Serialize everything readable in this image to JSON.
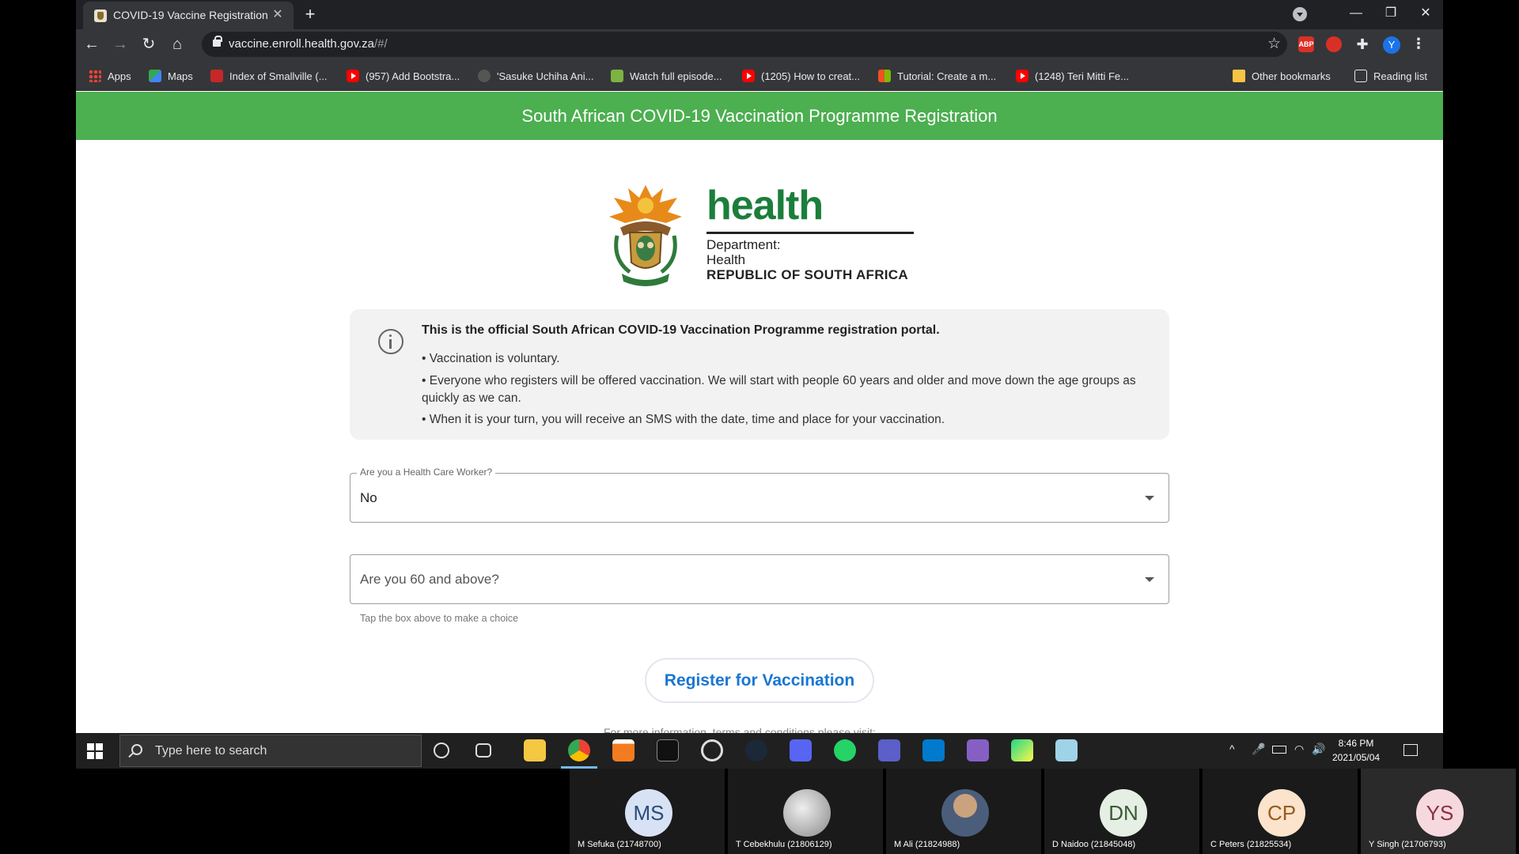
{
  "browser": {
    "tab_title": "COVID-19 Vaccine Registration",
    "tab_close": "✕",
    "new_tab": "+",
    "url_host": "vaccine.enroll.health.gov.za",
    "url_path": "/#/",
    "bookmarks": [
      {
        "label": "Apps",
        "icon": "apps-icon"
      },
      {
        "label": "Maps",
        "icon": "maps-icon"
      },
      {
        "label": "Index of Smallville (...",
        "icon": "site-icon"
      },
      {
        "label": "(957) Add Bootstra...",
        "icon": "youtube-icon"
      },
      {
        "label": "'Sasuke Uchiha Ani...",
        "icon": "site-icon"
      },
      {
        "label": "Watch full episode...",
        "icon": "site-icon"
      },
      {
        "label": "(1205) How to creat...",
        "icon": "youtube-icon"
      },
      {
        "label": "Tutorial: Create a m...",
        "icon": "microsoft-icon"
      },
      {
        "label": "(1248) Teri Mitti Fe...",
        "icon": "youtube-icon"
      }
    ],
    "other_bookmarks": "Other bookmarks",
    "reading_list": "Reading list",
    "profile_initial": "Y",
    "ext_abp": "ABP"
  },
  "page": {
    "header_title": "South African COVID-19 Vaccination Programme Registration",
    "logo": {
      "wordmark": "health",
      "line1": "Department:",
      "line2": "Health",
      "line3": "REPUBLIC OF SOUTH AFRICA"
    },
    "info": {
      "title": "This is the official South African COVID-19 Vaccination Programme registration portal.",
      "bullet1": "• Vaccination is voluntary.",
      "bullet2": "• Everyone who registers will be offered vaccination. We will start with people 60 years and older and move down the age groups as quickly as we can.",
      "bullet3": "• When it is your turn, you will receive an SMS with the date, time and place for your vaccination."
    },
    "health_worker_field": {
      "label": "Are you a Health Care Worker?",
      "value": "No"
    },
    "age_field": {
      "placeholder": "Are you 60 and above?",
      "hint": "Tap the box above to make a choice"
    },
    "register_button": "Register for Vaccination",
    "footer_partial": "For more information, terms and conditions please visit:"
  },
  "taskbar": {
    "search_placeholder": "Type here to search",
    "time": "8:46 PM",
    "date": "2021/05/04",
    "pinned": [
      "cortana-icon",
      "task-view-icon",
      "file-explorer-icon",
      "chrome-icon",
      "vlc-icon",
      "epic-games-icon",
      "obs-icon",
      "steam-icon",
      "discord-icon",
      "whatsapp-icon",
      "teams-icon",
      "vscode-icon",
      "visual-studio-icon",
      "pycharm-icon",
      "notepad-icon"
    ]
  },
  "participants": [
    {
      "initials": "MS",
      "name": "M Sefuka (21748700)",
      "color": "#d7e3f4",
      "text": "#2d4a7a"
    },
    {
      "initials": "",
      "name": "T Cebekhulu (21806129)",
      "color": "#cfcfcf",
      "text": "#333333"
    },
    {
      "initials": "",
      "name": "M Ali (21824988)",
      "color": "#6b7a8f",
      "text": "#ffffff"
    },
    {
      "initials": "DN",
      "name": "D Naidoo (21845048)",
      "color": "#e5efe3",
      "text": "#3b5a36"
    },
    {
      "initials": "CP",
      "name": "C Peters (21825534)",
      "color": "#fbe3cc",
      "text": "#9a5a1e"
    },
    {
      "initials": "YS",
      "name": "Y Singh (21706793)",
      "color": "#f6d9de",
      "text": "#8a2f42"
    }
  ]
}
